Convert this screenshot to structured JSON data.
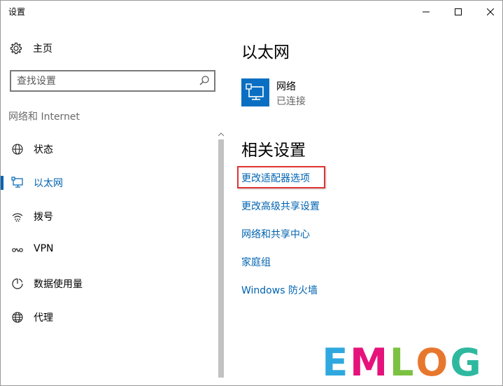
{
  "window": {
    "title": "设置"
  },
  "sidebar": {
    "home_label": "主页",
    "search_placeholder": "查找设置",
    "section_label": "网络和 Internet",
    "items": [
      {
        "label": "状态",
        "icon": "status-globe-icon",
        "selected": false
      },
      {
        "label": "以太网",
        "icon": "ethernet-icon",
        "selected": true
      },
      {
        "label": "拨号",
        "icon": "dial-up-icon",
        "selected": false
      },
      {
        "label": "VPN",
        "icon": "vpn-icon",
        "selected": false
      },
      {
        "label": "数据使用量",
        "icon": "data-usage-icon",
        "selected": false
      },
      {
        "label": "代理",
        "icon": "proxy-globe-icon",
        "selected": false
      }
    ]
  },
  "main": {
    "title": "以太网",
    "network": {
      "name": "网络",
      "status": "已连接",
      "icon": "monitor-network-icon"
    },
    "related_title": "相关设置",
    "links": [
      {
        "label": "更改适配器选项",
        "highlighted": true
      },
      {
        "label": "更改高级共享设置",
        "highlighted": false
      },
      {
        "label": "网络和共享中心",
        "highlighted": false
      },
      {
        "label": "家庭组",
        "highlighted": false
      },
      {
        "label": "Windows 防火墙",
        "highlighted": false
      }
    ]
  },
  "watermark": {
    "text": "EMLOG",
    "colors": [
      "#2fa8df",
      "#e6127c",
      "#7cc242",
      "#e8772e",
      "#2fb8a0"
    ]
  },
  "colors": {
    "accent": "#0063b1",
    "tile": "#0a6fc2",
    "highlight": "#e03434"
  }
}
